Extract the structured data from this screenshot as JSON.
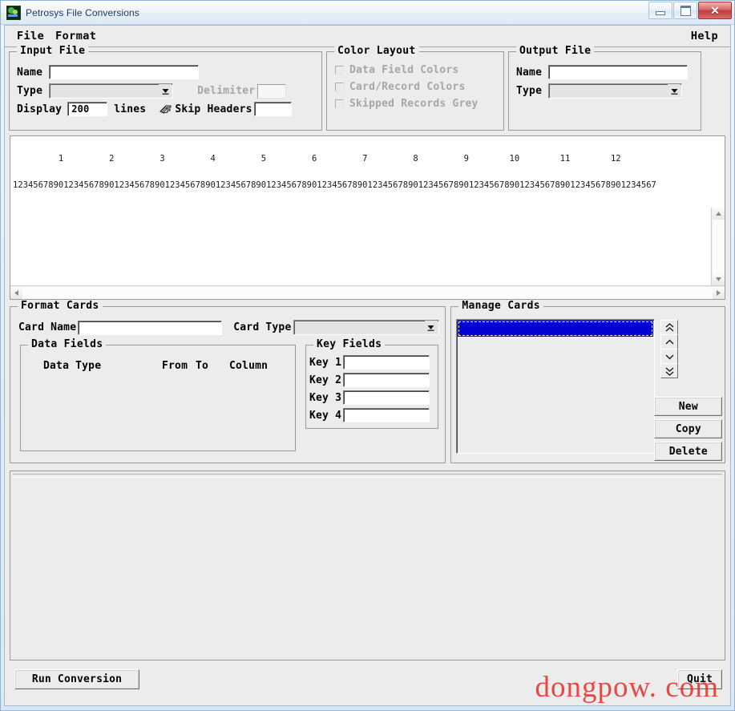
{
  "window": {
    "title": "Petrosys File Conversions",
    "icon": "app-icon",
    "buttons": {
      "minimize": "minimize-icon",
      "maximize": "maximize-icon",
      "close": "✕"
    }
  },
  "menubar": {
    "items": [
      {
        "label": "File"
      },
      {
        "label": "Format"
      }
    ],
    "help": "Help"
  },
  "input_file": {
    "legend": "Input File",
    "name_label": "Name",
    "name_value": "",
    "type_label": "Type",
    "type_value": "",
    "delimiter_label": "Delimiter",
    "delimiter_value": "",
    "display_label": "Display",
    "display_value": "200",
    "lines_label": "lines",
    "skip_headers_icon": "pointing-hand-icon",
    "skip_headers_label": "Skip Headers",
    "skip_headers_value": ""
  },
  "color_layout": {
    "legend": "Color Layout",
    "options": [
      {
        "label": "Data Field Colors",
        "checked": false
      },
      {
        "label": "Card/Record Colors",
        "checked": false
      },
      {
        "label": "Skipped Records Grey",
        "checked": false
      }
    ]
  },
  "output_file": {
    "legend": "Output File",
    "name_label": "Name",
    "name_value": "",
    "type_label": "Type",
    "type_value": ""
  },
  "ruler": {
    "tens": "         1         2         3         4         5         6         7         8         9        10        11        12",
    "units": "1234567890123456789012345678901234567890123456789012345678901234567890123456789012345678901234567890123456789012345678901234567"
  },
  "preview": {
    "content": ""
  },
  "format_cards": {
    "legend": "Format Cards",
    "card_name_label": "Card Name",
    "card_name_value": "",
    "card_type_label": "Card Type",
    "card_type_value": "",
    "data_fields": {
      "legend": "Data Fields",
      "columns": [
        "Data Type",
        "From",
        "To",
        "Column"
      ],
      "rows": []
    },
    "key_fields": {
      "legend": "Key Fields",
      "keys": [
        {
          "label": "Key 1",
          "value": ""
        },
        {
          "label": "Key 2",
          "value": ""
        },
        {
          "label": "Key 3",
          "value": ""
        },
        {
          "label": "Key 4",
          "value": ""
        }
      ]
    }
  },
  "manage_cards": {
    "legend": "Manage Cards",
    "items": [
      {
        "label": "",
        "selected": true
      }
    ],
    "nav": [
      {
        "name": "move-to-top",
        "glyph": "double-up-icon"
      },
      {
        "name": "move-up",
        "glyph": "up-icon"
      },
      {
        "name": "move-down",
        "glyph": "down-icon"
      },
      {
        "name": "move-to-bottom",
        "glyph": "double-down-icon"
      }
    ],
    "buttons": [
      {
        "label": "New"
      },
      {
        "label": "Copy"
      },
      {
        "label": "Delete"
      }
    ]
  },
  "footer": {
    "run_label": "Run Conversion",
    "quit_label": "Quit",
    "watermark": "dongpow. com"
  },
  "colors": {
    "selection_blue": "#0000d2",
    "watermark_red": "#e8251f",
    "close_red": "#c03b3b",
    "window_bg": "#ececed",
    "disabled_text": "#a6a6a6"
  }
}
